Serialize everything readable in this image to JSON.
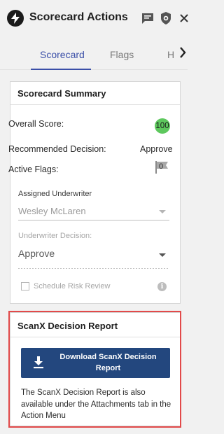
{
  "header": {
    "title": "Scorecard Actions",
    "icons": [
      "bolt-logo-icon",
      "chat-icon",
      "shield-icon",
      "close-icon"
    ]
  },
  "tabs": [
    {
      "label": "Scorecard",
      "active": true
    },
    {
      "label": "Flags",
      "active": false
    },
    {
      "label": "H",
      "active": false
    }
  ],
  "summary": {
    "title": "Scorecard Summary",
    "overall_score_label": "Overall Score:",
    "overall_score": "100",
    "recommended_decision_label": "Recommended Decision:",
    "recommended_decision": "Approve",
    "active_flags_label": "Active Flags:",
    "active_flags": "0",
    "underwriter_label": "Assigned Underwriter",
    "underwriter_value": "Wesley McLaren",
    "decision_label": "Underwriter Decision:",
    "decision_value": "Approve",
    "schedule_label": "Schedule Risk Review",
    "schedule_checked": false
  },
  "report": {
    "title": "ScanX Decision Report",
    "button_label": "Download ScanX Decision Report",
    "note": "The ScanX Decision Report is also available under the Attachments tab in the Action Menu"
  },
  "colors": {
    "accent": "#3b4fa8",
    "score_green": "#5dc85d",
    "button_blue": "#23477e",
    "highlight_red": "#e24a4a"
  }
}
